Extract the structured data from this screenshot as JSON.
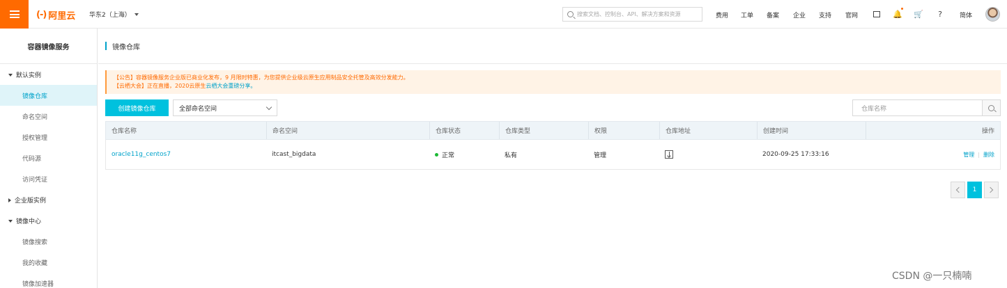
{
  "topbar": {
    "logo_mark": "(-)",
    "logo_text": "阿里云",
    "region": "华东2（上海）",
    "search_placeholder": "搜索文档、控制台、API、解决方案和资源",
    "nav_links": [
      "费用",
      "工单",
      "备案",
      "企业",
      "支持",
      "官网"
    ],
    "language": "简体"
  },
  "sidebar": {
    "title": "容器镜像服务",
    "group_default": "默认实例",
    "default_items": [
      "镜像仓库",
      "命名空间",
      "授权管理",
      "代码源",
      "访问凭证"
    ],
    "group_enterprise": "企业版实例",
    "group_center": "镜像中心",
    "center_items": [
      "镜像搜索",
      "我的收藏",
      "镜像加速器"
    ]
  },
  "page": {
    "title": "镜像仓库"
  },
  "notice": {
    "line1": "【公告】容器镜像服务企业版已商业化发布，9 月限时特惠，为您提供企业级云原生应用制品安全托管及高效分发能力。",
    "line2_prefix": "【云栖大会】正在直播，2020云原生",
    "line2_link": "云栖大会重磅分享。"
  },
  "toolbar": {
    "create_label": "创建镜像仓库",
    "namespace_select": "全部命名空间",
    "repo_search_placeholder": "仓库名称"
  },
  "table": {
    "headers": [
      "仓库名称",
      "命名空间",
      "仓库状态",
      "仓库类型",
      "权限",
      "仓库地址",
      "创建时间",
      "操作"
    ],
    "rows": [
      {
        "name": "oracle11g_centos7",
        "namespace": "itcast_bigdata",
        "status": "正常",
        "type": "私有",
        "permission": "管理",
        "created": "2020-09-25 17:33:16",
        "op_manage": "管理",
        "op_sep": "|",
        "op_delete": "删除"
      }
    ]
  },
  "pagination": {
    "current": "1"
  },
  "watermark": "CSDN @一只楠喃",
  "colors": {
    "brand_orange": "#ff6a00",
    "accent_cyan": "#00c1de",
    "link_blue": "#00a2ca",
    "status_green": "#1bb934"
  }
}
